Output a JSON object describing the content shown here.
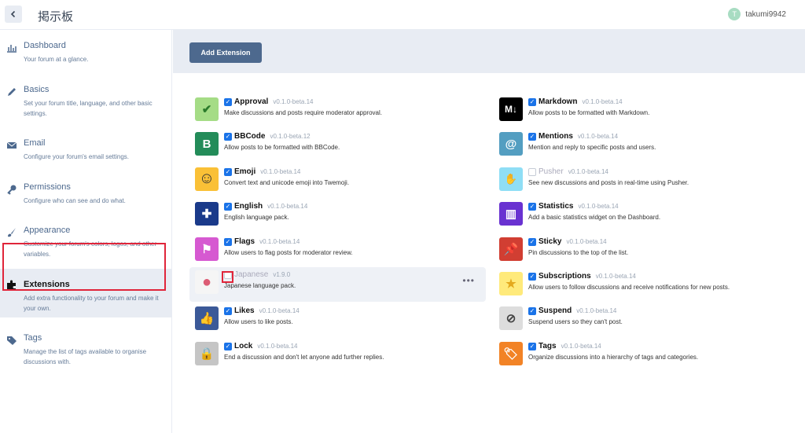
{
  "header": {
    "site_title": "掲示板",
    "username": "takumi9942",
    "avatar_letter": "T"
  },
  "sidebar": {
    "items": [
      {
        "label": "Dashboard",
        "desc": "Your forum at a glance.",
        "icon": "chart-icon"
      },
      {
        "label": "Basics",
        "desc": "Set your forum title, language, and other basic settings.",
        "icon": "pencil-icon"
      },
      {
        "label": "Email",
        "desc": "Configure your forum's email settings.",
        "icon": "envelope-icon"
      },
      {
        "label": "Permissions",
        "desc": "Configure who can see and do what.",
        "icon": "key-icon"
      },
      {
        "label": "Appearance",
        "desc": "Customize your forum's colors, logos, and other variables.",
        "icon": "paintbrush-icon"
      },
      {
        "label": "Extensions",
        "desc": "Add extra functionality to your forum and make it your own.",
        "icon": "puzzle-icon"
      },
      {
        "label": "Tags",
        "desc": "Manage the list of tags available to organise discussions with.",
        "icon": "tag-icon"
      }
    ]
  },
  "toolbar": {
    "add_extension": "Add Extension"
  },
  "extensions_left": [
    {
      "name": "Approval",
      "version": "v0.1.0-beta.14",
      "desc": "Make discussions and posts require moderator approval.",
      "enabled": true,
      "color": "#a5dc86",
      "glyph": "✔"
    },
    {
      "name": "BBCode",
      "version": "v0.1.0-beta.12",
      "desc": "Allow posts to be formatted with BBCode.",
      "enabled": true,
      "color": "#238c59",
      "glyph": "B"
    },
    {
      "name": "Emoji",
      "version": "v0.1.0-beta.14",
      "desc": "Convert text and unicode emoji into Twemoji.",
      "enabled": true,
      "color": "#fac036",
      "glyph": "☺"
    },
    {
      "name": "English",
      "version": "v0.1.0-beta.14",
      "desc": "English language pack.",
      "enabled": true,
      "color": "#1a3a8a",
      "glyph": "✚"
    },
    {
      "name": "Flags",
      "version": "v0.1.0-beta.14",
      "desc": "Allow users to flag posts for moderator review.",
      "enabled": true,
      "color": "#d659d1",
      "glyph": "⚑"
    },
    {
      "name": "Japanese",
      "version": "v1.9.0",
      "desc": "Japanese language pack.",
      "enabled": false,
      "color": "#f5f5f5",
      "glyph": "●",
      "more": "•••"
    },
    {
      "name": "Likes",
      "version": "v0.1.0-beta.14",
      "desc": "Allow users to like posts.",
      "enabled": true,
      "color": "#3b5998",
      "glyph": "👍"
    },
    {
      "name": "Lock",
      "version": "v0.1.0-beta.14",
      "desc": "End a discussion and don't let anyone add further replies.",
      "enabled": true,
      "color": "#c5c5c5",
      "glyph": "🔒"
    }
  ],
  "extensions_right": [
    {
      "name": "Markdown",
      "version": "v0.1.0-beta.14",
      "desc": "Allow posts to be formatted with Markdown.",
      "enabled": true,
      "color": "#000000",
      "glyph": "M↓"
    },
    {
      "name": "Mentions",
      "version": "v0.1.0-beta.14",
      "desc": "Mention and reply to specific posts and users.",
      "enabled": true,
      "color": "#539ec1",
      "glyph": "@"
    },
    {
      "name": "Pusher",
      "version": "v0.1.0-beta.14",
      "desc": "See new discussions and posts in real-time using Pusher.",
      "enabled": false,
      "color": "#8fdef5",
      "glyph": "✋"
    },
    {
      "name": "Statistics",
      "version": "v0.1.0-beta.14",
      "desc": "Add a basic statistics widget on the Dashboard.",
      "enabled": true,
      "color": "#6932d1",
      "glyph": "▥"
    },
    {
      "name": "Sticky",
      "version": "v0.1.0-beta.14",
      "desc": "Pin discussions to the top of the list.",
      "enabled": true,
      "color": "#d13e32",
      "glyph": "📌"
    },
    {
      "name": "Subscriptions",
      "version": "v0.1.0-beta.14",
      "desc": "Allow users to follow discussions and receive notifications for new posts.",
      "enabled": true,
      "color": "#ffea7b",
      "glyph": "★"
    },
    {
      "name": "Suspend",
      "version": "v0.1.0-beta.14",
      "desc": "Suspend users so they can't post.",
      "enabled": true,
      "color": "#dddddd",
      "glyph": "⊘"
    },
    {
      "name": "Tags",
      "version": "v0.1.0-beta.14",
      "desc": "Organize discussions into a hierarchy of tags and categories.",
      "enabled": true,
      "color": "#f28326",
      "glyph": "🏷"
    }
  ]
}
